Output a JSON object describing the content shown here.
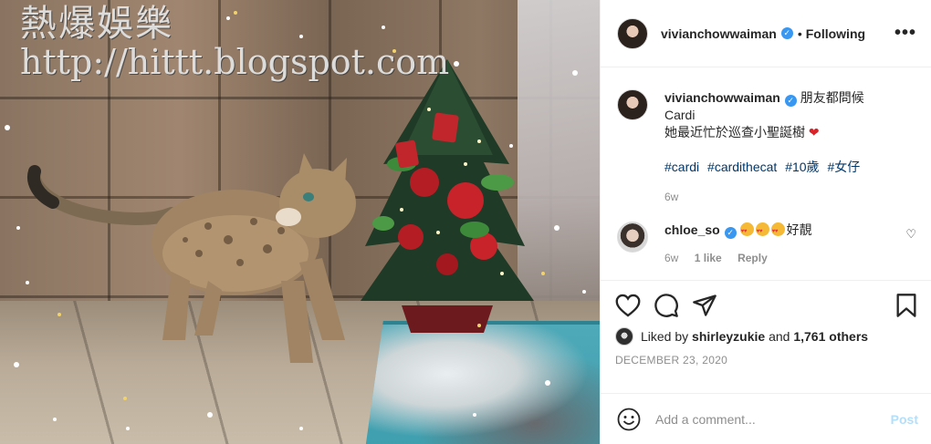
{
  "watermark": {
    "line1": "熱爆娛樂",
    "line2": "http://hittt.blogspot.com"
  },
  "header": {
    "username": "vivianchowwaiman",
    "separator": "•",
    "follow_label": "Following",
    "more_label": "•••"
  },
  "caption": {
    "username": "vivianchowwaiman",
    "lines": [
      "朋友都問候",
      "Cardi",
      "她最近忙於巡查小聖誕樹"
    ],
    "hashtags": [
      "#cardi",
      "#cardithecat",
      "#10歲",
      "#女仔"
    ],
    "age": "6w"
  },
  "comment": {
    "username": "chloe_so",
    "text": "好靚",
    "age": "6w",
    "likes": "1 like",
    "reply_label": "Reply"
  },
  "likes": {
    "prefix": "Liked by",
    "user": "shirleyzukie",
    "middle": "and",
    "others": "1,761 others"
  },
  "date": "DECEMBER 23, 2020",
  "add_comment": {
    "placeholder": "Add a comment...",
    "post_label": "Post"
  },
  "colors": {
    "link": "#00376b",
    "verified": "#3897f0",
    "post_disabled": "#b2dffc",
    "muted": "#8e8e8e"
  }
}
